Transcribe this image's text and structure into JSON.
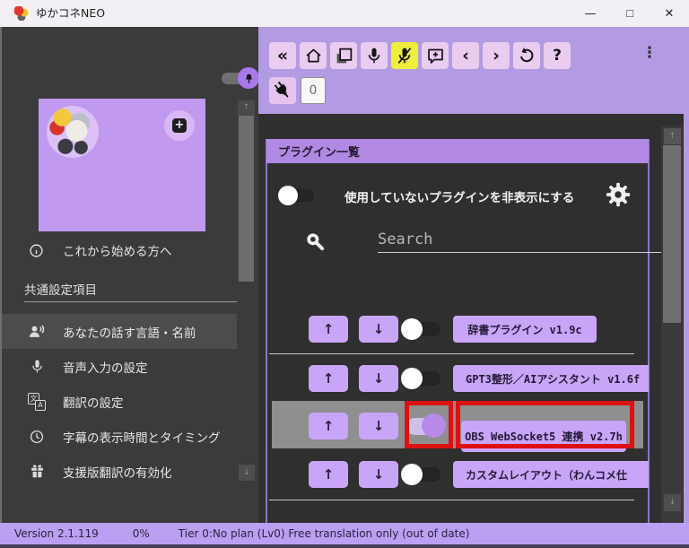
{
  "titlebar": {
    "title": "ゆかコネNEO",
    "minimize_glyph": "—",
    "maximize_glyph": "☐",
    "close_glyph": "✕"
  },
  "toolbar": {
    "back_glyph": "«",
    "prev_glyph": "‹",
    "next_glyph": "›",
    "help_glyph": "?",
    "menu_glyph": "⋮",
    "plugin_counter": "0"
  },
  "sidebar": {
    "getting_started_label": "これから始める方へ",
    "section_header": "共通設定項目",
    "translate_icon_glyphs": {
      "cjk": "文",
      "latin": "A"
    },
    "scroll_up_glyph": "↑",
    "scroll_down_glyph": "↓",
    "items": [
      {
        "label": "あなたの話す言語・名前",
        "selected": true
      },
      {
        "label": "音声入力の設定",
        "selected": false
      },
      {
        "label": "翻訳の設定",
        "selected": false
      },
      {
        "label": "字幕の表示時間とタイミング",
        "selected": false
      },
      {
        "label": "支援版翻訳の有効化",
        "selected": false
      }
    ]
  },
  "plugin_panel": {
    "title": "プラグイン一覧",
    "hide_unused_label": "使用していないプラグインを非表示にする",
    "hide_unused_enabled": false,
    "search_placeholder": "Search",
    "move_up_glyph": "↑",
    "move_down_glyph": "↓",
    "plugins": [
      {
        "name": "辞書プラグイン v1.9c",
        "enabled": false,
        "highlighted": false
      },
      {
        "name": "GPT3整形／AIアシスタント v1.6f",
        "enabled": false,
        "highlighted": false
      },
      {
        "name": "OBS WebSocket5 連携 v2.7h",
        "enabled": true,
        "highlighted": true
      },
      {
        "name": "カスタムレイアウト（わんコメ仕",
        "enabled": false,
        "highlighted": false
      }
    ]
  },
  "statusbar": {
    "version": "Version 2.1.119",
    "progress": "0%",
    "tier": "Tier 0:No plan (Lv0) Free translation only (out of date)"
  },
  "colors": {
    "accent_purple": "#b29be2",
    "button_lavender": "#eaccf0",
    "control_purple": "#c9a5f7",
    "panel_header_purple": "#b289e2",
    "mute_active_yellow": "#f0ee3c",
    "highlight_gray": "#8f8f8f",
    "annotation_red": "#dd1111",
    "statusbar_purple": "#bb9ff2"
  }
}
